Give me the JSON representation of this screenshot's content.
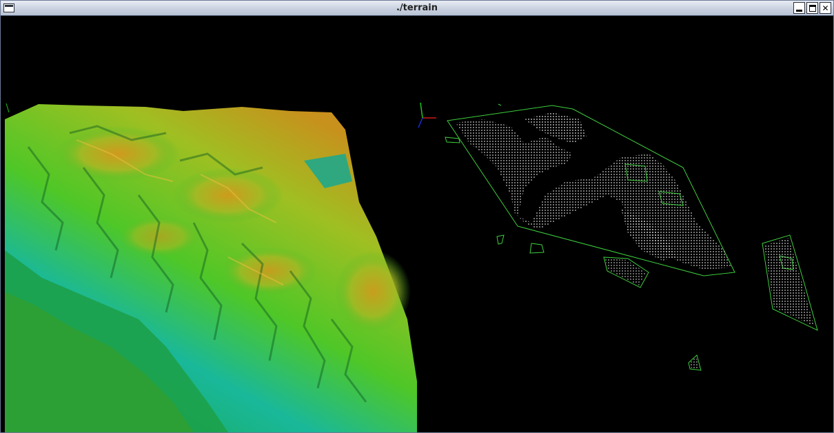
{
  "window": {
    "title": "./terrain",
    "buttons": {
      "minimize": "minimize-icon",
      "maximize": "maximize-icon",
      "close": "close-icon"
    }
  },
  "colors": {
    "background": "#000000",
    "outline": "#3ecf3e",
    "point_cloud": "#e0e0e0",
    "terrain_low": "#13a85a",
    "terrain_mid": "#3fbf2a",
    "terrain_high": "#c8901c",
    "axis_x": "#d01818",
    "axis_y": "#18c818",
    "axis_z": "#1a2bd6"
  }
}
